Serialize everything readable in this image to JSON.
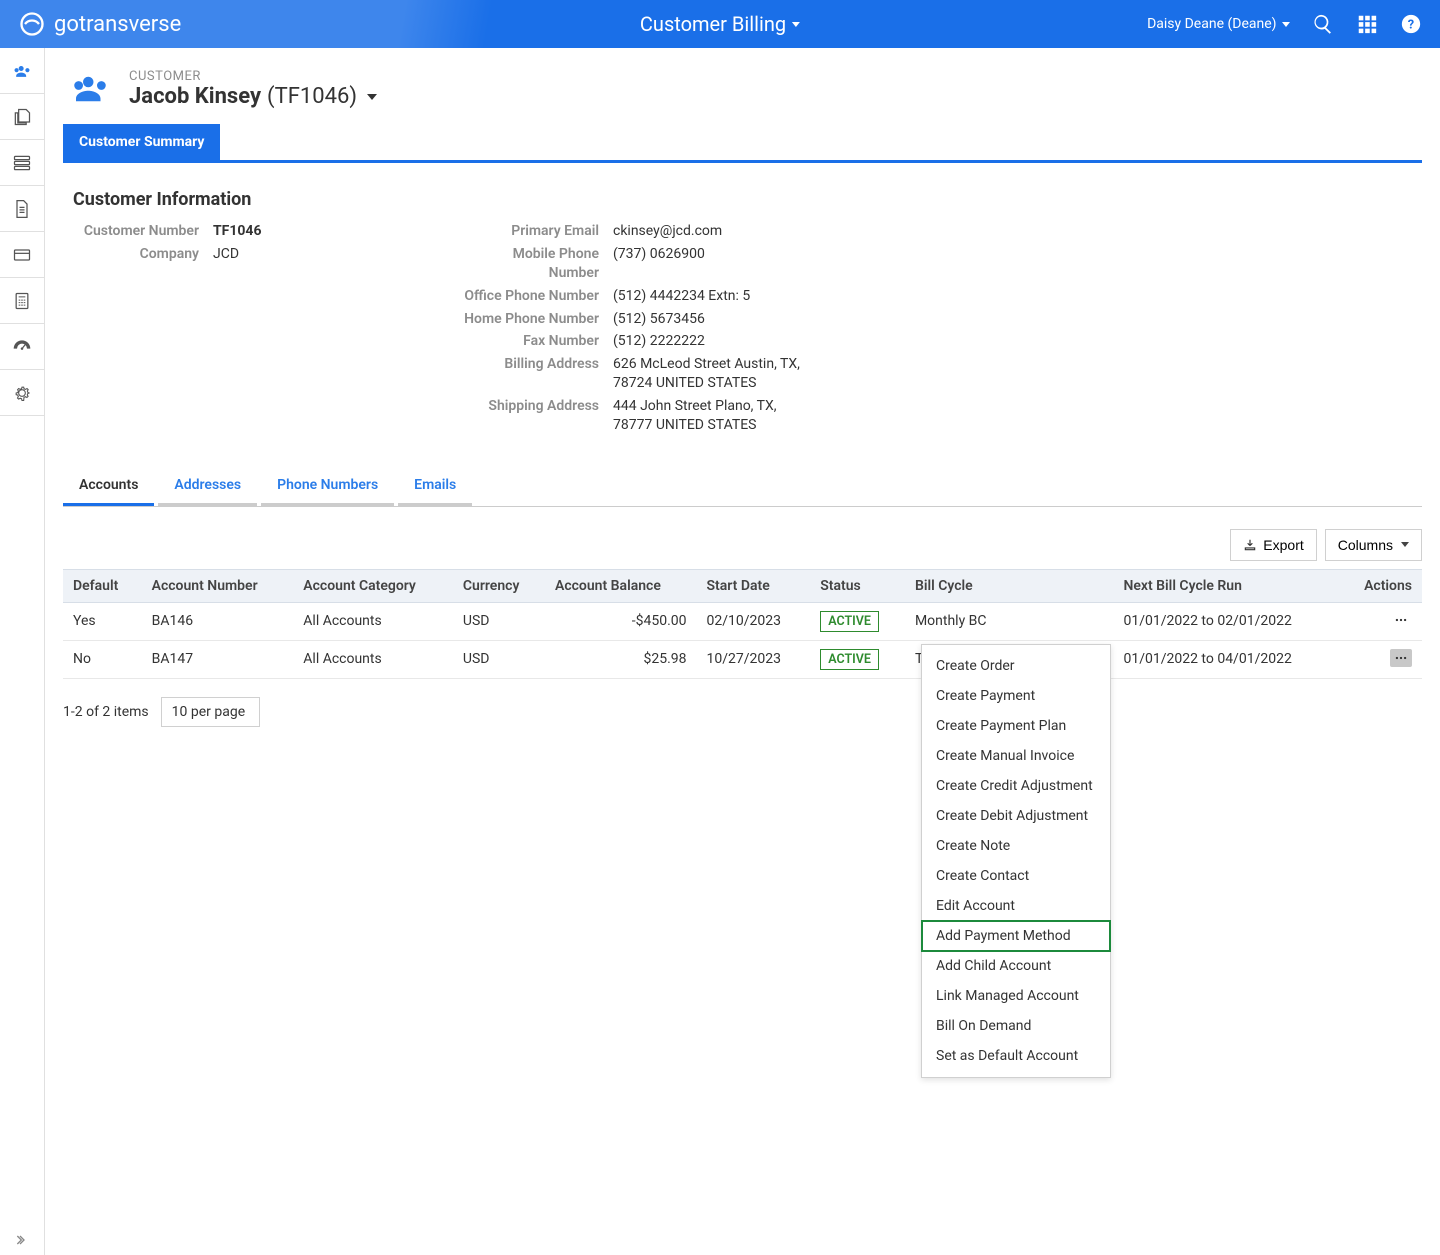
{
  "header": {
    "brand": "gotransverse",
    "app_title": "Customer Billing",
    "user_label": "Daisy Deane (Deane)"
  },
  "page": {
    "entity_label": "CUSTOMER",
    "name": "Jacob Kinsey",
    "number_display": "(TF1046)"
  },
  "top_tabs": {
    "active": "Customer Summary"
  },
  "customer_info": {
    "title": "Customer Information",
    "left": [
      {
        "label": "Customer Number",
        "value": "TF1046",
        "bold": true
      },
      {
        "label": "Company",
        "value": "JCD"
      }
    ],
    "right": [
      {
        "label": "Primary Email",
        "value": "ckinsey@jcd.com"
      },
      {
        "label": "Mobile Phone Number",
        "value": "(737) 0626900"
      },
      {
        "label": "Office Phone Number",
        "value": "(512) 4442234 Extn: 5"
      },
      {
        "label": "Home Phone Number",
        "value": "(512) 5673456"
      },
      {
        "label": "Fax Number",
        "value": "(512) 2222222"
      },
      {
        "label": "Billing Address",
        "value": "626 McLeod Street Austin, TX, 78724 UNITED STATES"
      },
      {
        "label": "Shipping Address",
        "value": "444 John Street Plano, TX, 78777 UNITED STATES"
      }
    ]
  },
  "subtabs": [
    "Accounts",
    "Addresses",
    "Phone Numbers",
    "Emails"
  ],
  "table_toolbar": {
    "export": "Export",
    "columns": "Columns"
  },
  "accounts": {
    "columns": [
      "Default",
      "Account Number",
      "Account Category",
      "Currency",
      "Account Balance",
      "Start Date",
      "Status",
      "Bill Cycle",
      "Next Bill Cycle Run",
      "Actions"
    ],
    "rows": [
      {
        "default": "Yes",
        "account_number": "BA146",
        "category": "All Accounts",
        "currency": "USD",
        "balance": "-$450.00",
        "start": "02/10/2023",
        "status": "ACTIVE",
        "bill_cycle": "Monthly BC",
        "next_run": "01/01/2022 to 02/01/2022"
      },
      {
        "default": "No",
        "account_number": "BA147",
        "category": "All Accounts",
        "currency": "USD",
        "balance": "$25.98",
        "start": "10/27/2023",
        "status": "ACTIVE",
        "bill_cycle": "TF Monitored (Quarterly)",
        "next_run": "01/01/2022 to 04/01/2022"
      }
    ]
  },
  "pager": {
    "summary": "1-2 of 2 items",
    "size": "10 per page"
  },
  "context_menu": {
    "items": [
      "Create Order",
      "Create Payment",
      "Create Payment Plan",
      "Create Manual Invoice",
      "Create Credit Adjustment",
      "Create Debit Adjustment",
      "Create Note",
      "Create Contact",
      "Edit Account",
      "Add Payment Method",
      "Add Child Account",
      "Link Managed Account",
      "Bill On Demand",
      "Set as Default Account"
    ],
    "highlight_index": 9
  }
}
